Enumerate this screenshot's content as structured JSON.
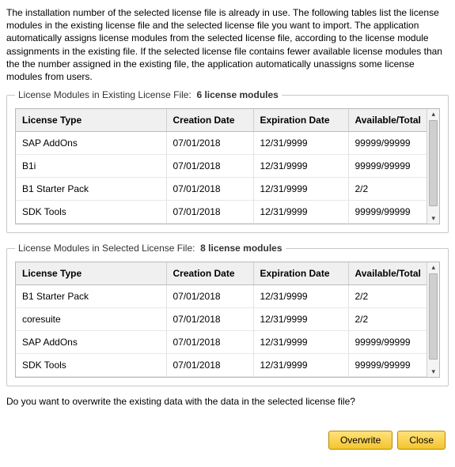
{
  "intro": "The installation number of the selected license file is already in use. The following tables list the license modules in the existing license file and the selected license file you want to import.\nThe application automatically assigns license modules from the selected license file, according to the license module assignments in the existing file. If the selected license file contains fewer available license modules than the the number assigned in the existing file, the application automatically unassigns some license modules from users.",
  "existing": {
    "legend_prefix": "License Modules in Existing License File:",
    "count_label": "6 license modules",
    "headers": {
      "type": "License Type",
      "created": "Creation Date",
      "expires": "Expiration Date",
      "avail": "Available/Total"
    },
    "rows": [
      {
        "type": "SAP AddOns",
        "created": "07/01/2018",
        "expires": "12/31/9999",
        "avail": "99999/99999"
      },
      {
        "type": "B1i",
        "created": "07/01/2018",
        "expires": "12/31/9999",
        "avail": "99999/99999"
      },
      {
        "type": "B1 Starter Pack",
        "created": "07/01/2018",
        "expires": "12/31/9999",
        "avail": "2/2"
      },
      {
        "type": "SDK Tools",
        "created": "07/01/2018",
        "expires": "12/31/9999",
        "avail": "99999/99999"
      }
    ]
  },
  "selected": {
    "legend_prefix": "License Modules in Selected License File:",
    "count_label": "8 license modules",
    "headers": {
      "type": "License Type",
      "created": "Creation Date",
      "expires": "Expiration Date",
      "avail": "Available/Total"
    },
    "rows": [
      {
        "type": "B1 Starter Pack",
        "created": "07/01/2018",
        "expires": "12/31/9999",
        "avail": "2/2"
      },
      {
        "type": "coresuite",
        "created": "07/01/2018",
        "expires": "12/31/9999",
        "avail": "2/2"
      },
      {
        "type": "SAP AddOns",
        "created": "07/01/2018",
        "expires": "12/31/9999",
        "avail": "99999/99999"
      },
      {
        "type": "SDK Tools",
        "created": "07/01/2018",
        "expires": "12/31/9999",
        "avail": "99999/99999"
      }
    ]
  },
  "question": "Do you want to overwrite the existing data with the data in the selected license file?",
  "buttons": {
    "overwrite": "Overwrite",
    "close": "Close"
  }
}
